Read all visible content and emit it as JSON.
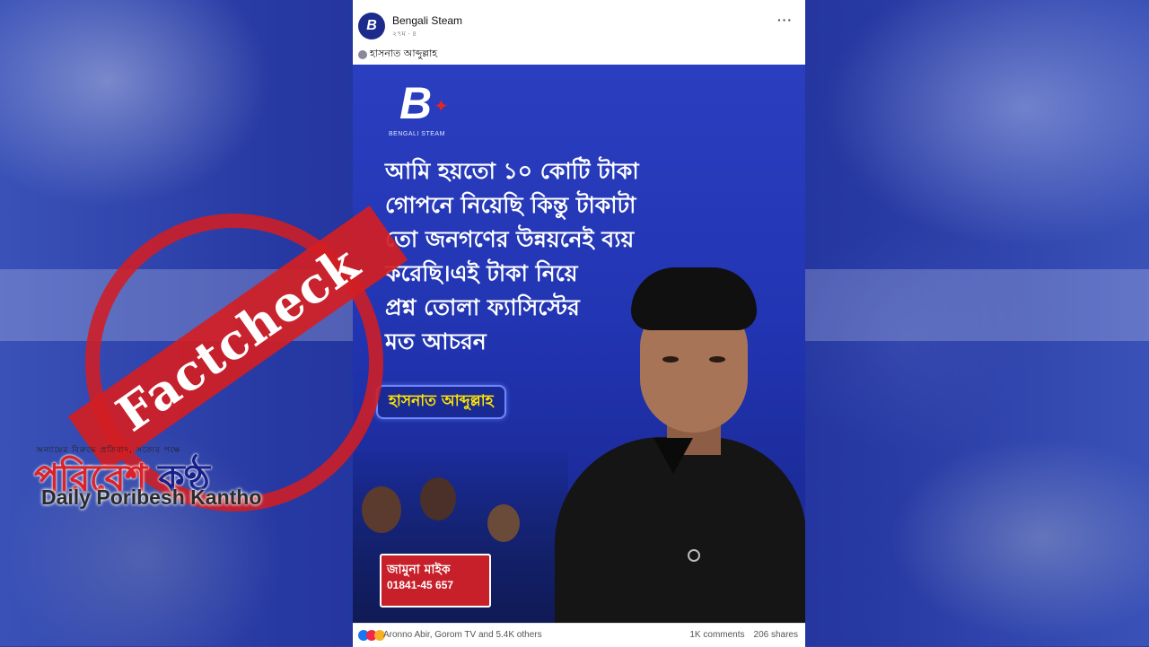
{
  "post": {
    "page_name": "Bengali Steam",
    "time": "২৭ম · ৪",
    "caption": "হাসনাত আব্দুল্লাহ",
    "more_label": "···",
    "avatar_letter": "B",
    "image": {
      "logo_letter": "B",
      "logo_text": "BENGALI STEAM",
      "quote_lines": [
        "আমি হয়তো ১০ কোটি টাকা",
        "গোপনে নিয়েছি কিন্তু টাকাটা",
        "তো জনগণের উন্নয়নেই ব্যয়",
        "করেছি।এই টাকা নিয়ে",
        "প্রশ্ন তোলা ফ্যাসিস্টের",
        "মত আচরন"
      ],
      "name_badge": "হাসনাত আব্দুল্লাহ",
      "mic_text_1": "জামুনা মাইক",
      "mic_text_2": "01841-45 657"
    },
    "reactions_text": "Aronno Abir, Gorom TV and 5.4K others",
    "comments": "1K comments",
    "shares": "206 shares"
  },
  "overlay": {
    "stamp_text": "Factcheck",
    "watermark_top": "অন্যায়ের বিরুদ্ধে প্রতিবাদ, সত্যের পক্ষে",
    "watermark_bengali_1": "পরিবেশ",
    "watermark_bengali_2": " কণ্ঠ",
    "watermark_english": "Daily Poribesh Kantho"
  },
  "colors": {
    "stamp_red": "#d21e23",
    "badge_yellow": "#ffe500",
    "brand_blue": "#17208a"
  }
}
